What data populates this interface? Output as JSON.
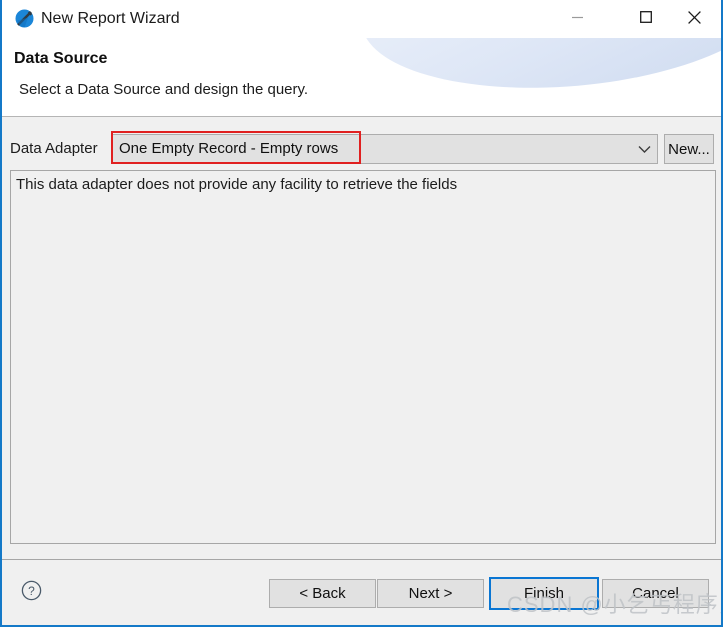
{
  "window": {
    "title": "New Report Wizard",
    "icon": "jaspersoft-report-icon",
    "controls": {
      "minimize": "minimize-icon",
      "maximize": "maximize-icon",
      "close": "close-icon"
    }
  },
  "header": {
    "title": "Data Source",
    "subtitle": "Select a Data Source and design the query."
  },
  "form": {
    "adapter_label": "Data Adapter",
    "adapter_value": "One Empty Record - Empty rows",
    "adapter_arrow_icon": "chevron-down-icon",
    "new_button_label": "New..."
  },
  "fields_panel": {
    "message": "This data adapter does not provide any facility to retrieve the fields"
  },
  "footer": {
    "help_icon": "help-circle-icon",
    "back_label": "< Back",
    "next_label": "Next >",
    "finish_label": "Finish",
    "cancel_label": "Cancel"
  },
  "annotation": {
    "color": "#e02020"
  },
  "watermark": {
    "text": "CSDN @小乞丐程序员"
  },
  "colors": {
    "window_border": "#1479c8",
    "dialog_bg": "#f0f0f0",
    "control_bg": "#e1e1e1",
    "control_border": "#adadad",
    "focus_border": "#0a76d3",
    "annotation_red": "#e02020"
  }
}
